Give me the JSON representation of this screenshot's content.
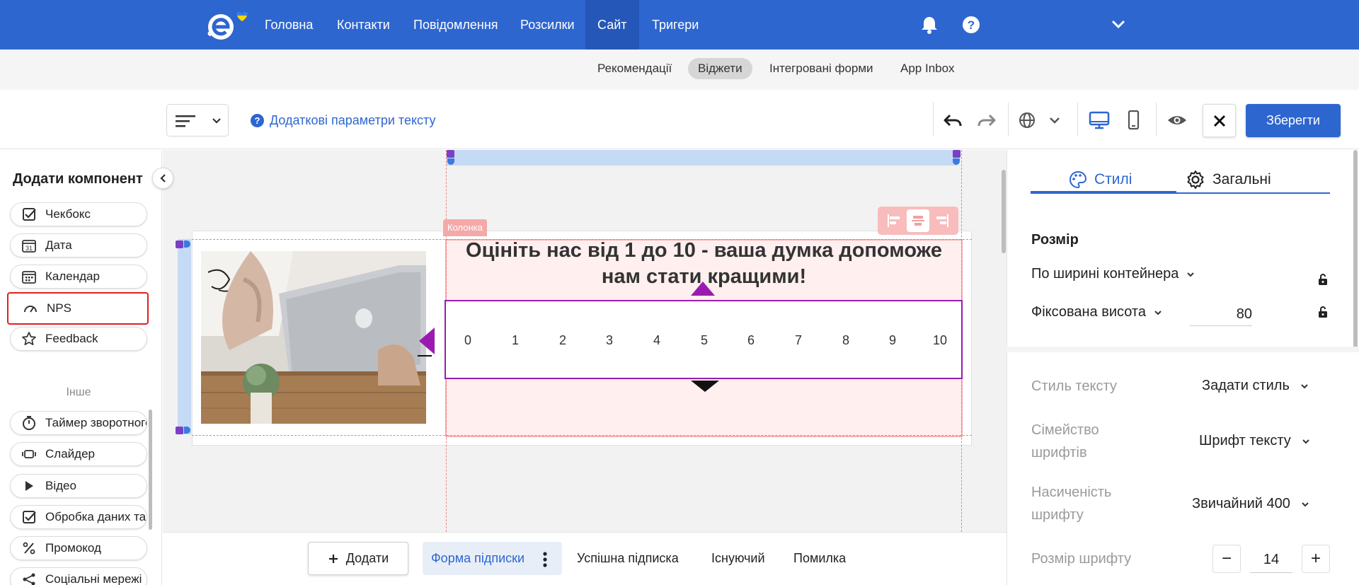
{
  "topnav": {
    "items": [
      "Головна",
      "Контакти",
      "Повідомлення",
      "Розсилки",
      "Сайт",
      "Тригери"
    ],
    "active": "Сайт"
  },
  "subnav": {
    "items": [
      "Рекомендації",
      "Віджети",
      "Інтегровані форми",
      "App Inbox"
    ],
    "active": "Віджети"
  },
  "toolbar": {
    "help_label": "Додаткові параметри тексту",
    "save_label": "Зберегти"
  },
  "left_panel": {
    "title": "Додати компонент",
    "components": [
      {
        "label": "Чекбокс",
        "icon": "checkbox-icon"
      },
      {
        "label": "Дата",
        "icon": "date-icon"
      },
      {
        "label": "Календар",
        "icon": "calendar-icon"
      },
      {
        "label": "NPS",
        "icon": "gauge-icon"
      },
      {
        "label": "Feedback",
        "icon": "star-icon"
      }
    ],
    "other_section": "Інше",
    "other_components": [
      {
        "label": "Таймер зворотного відліку",
        "icon": "timer-icon"
      },
      {
        "label": "Слайдер",
        "icon": "slider-icon"
      },
      {
        "label": "Відео",
        "icon": "play-icon"
      },
      {
        "label": "Обробка даних та",
        "icon": "checkbox-icon"
      },
      {
        "label": "Промокод",
        "icon": "percent-icon"
      },
      {
        "label": "Соціальні мережі",
        "icon": "share-icon"
      }
    ]
  },
  "canvas": {
    "column_tag": "Колонка",
    "heading": "Оцініть нас від 1 до 10 - ваша думка допоможе нам стати кращими!",
    "nps_scale": [
      "0",
      "1",
      "2",
      "3",
      "4",
      "5",
      "6",
      "7",
      "8",
      "9",
      "10"
    ]
  },
  "bottom": {
    "add_label": "Додати",
    "tabs": [
      "Форма підписки",
      "Успішна підписка",
      "Існуючий",
      "Помилка"
    ],
    "active_tab": "Форма підписки"
  },
  "right_panel": {
    "tabs": [
      "Стилі",
      "Загальні"
    ],
    "active_tab": "Стилі",
    "size_title": "Розмір",
    "width_mode": "По ширині контейнера",
    "height_mode": "Фіксована висота",
    "height_value": "80",
    "props": [
      {
        "label": "Стиль тексту",
        "value": "Задати стиль"
      },
      {
        "label": "Сімейство шрифтів",
        "value": "Шрифт тексту"
      },
      {
        "label": "Насиченість шрифту",
        "value": "Звичайний 400"
      },
      {
        "label": "Розмір шрифту",
        "value": "14"
      }
    ]
  },
  "colors": {
    "brand": "#2e66d0",
    "nps_selection": "#9b1bb1",
    "column_highlight": "#f5a8a8",
    "npm_highlight_border": "#e02020"
  }
}
